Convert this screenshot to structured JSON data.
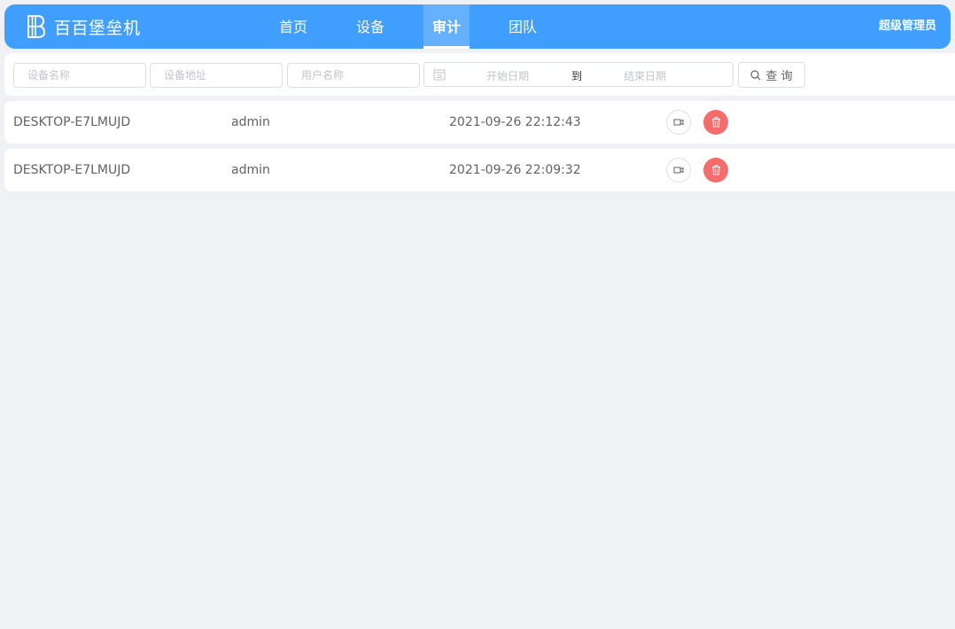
{
  "navbar": {
    "brand_name": "百百堡垒机",
    "nav_items": [
      {
        "label": "首页"
      },
      {
        "label": "设备"
      },
      {
        "label": "审计",
        "active": true
      },
      {
        "label": "团队"
      }
    ],
    "user_label": "超级管理员"
  },
  "filters": {
    "device_name_placeholder": "设备名称",
    "device_address_placeholder": "设备地址",
    "username_placeholder": "用户名称",
    "start_date_placeholder": "开始日期",
    "range_separator": "到",
    "end_date_placeholder": "结束日期",
    "query_label": "查 询"
  },
  "records": [
    {
      "device": "DESKTOP-E7LMUJD",
      "user": "admin",
      "time": "2021-09-26 22:12:43"
    },
    {
      "device": "DESKTOP-E7LMUJD",
      "user": "admin",
      "time": "2021-09-26 22:09:32"
    }
  ],
  "colors": {
    "primary": "#409eff",
    "active_tab": "#66b1ff",
    "danger": "#f56c6c",
    "background": "#f0f1f5"
  },
  "icons": {
    "logo": "brand-logo-icon",
    "calendar": "calendar-icon",
    "search": "search-icon",
    "record": "video-camera-icon",
    "delete": "trash-icon"
  }
}
